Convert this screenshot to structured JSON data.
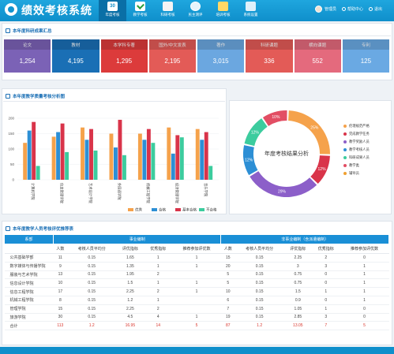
{
  "app": {
    "title": "绩效考核系统"
  },
  "nav": [
    {
      "label": "年度考核",
      "icon": "calendar-icon",
      "badge": "30"
    },
    {
      "label": "教学考核",
      "icon": "checklist-icon"
    },
    {
      "label": "科研考核",
      "icon": "researcher-icon"
    },
    {
      "label": "民主测评",
      "icon": "globe-icon"
    },
    {
      "label": "培训考核",
      "icon": "note-icon"
    },
    {
      "label": "系统设置",
      "icon": "document-icon"
    }
  ],
  "user": {
    "name": "管理员",
    "help": "帮助中心",
    "logout": "退出"
  },
  "summary": {
    "title": "本年度科研成果汇总",
    "cards": [
      {
        "label": "论文",
        "value": "1,254",
        "color": "#7b62b6"
      },
      {
        "label": "教材",
        "value": "4,195",
        "color": "#1a6fb5"
      },
      {
        "label": "本学科专著",
        "value": "1,295",
        "color": "#dc3b3b"
      },
      {
        "label": "国外/中文发表",
        "value": "2,195",
        "color": "#e35b57"
      },
      {
        "label": "著作",
        "value": "3,015",
        "color": "#6ba7e0"
      },
      {
        "label": "科研课题",
        "value": "336",
        "color": "#e35b57"
      },
      {
        "label": "横向课题",
        "value": "552",
        "color": "#e46a7d"
      },
      {
        "label": "专利",
        "value": "125",
        "color": "#6aa9e3"
      }
    ]
  },
  "bar_section": {
    "title": "本年度教学质量考核分析图"
  },
  "chart_data": [
    {
      "type": "bar",
      "categories": [
        "计算机学院",
        "信息管理学院",
        "艺术设计学院",
        "外国语学院",
        "机械工程学院",
        "经济管理学院",
        "音乐学院"
      ],
      "ylim": [
        0,
        200
      ],
      "yticks": [
        0,
        50,
        100,
        150,
        200
      ],
      "series": [
        {
          "name": "优秀",
          "color": "#f5a24b",
          "values": [
            120,
            140,
            170,
            150,
            150,
            170,
            165
          ]
        },
        {
          "name": "合格",
          "color": "#2d8fd5",
          "values": [
            160,
            155,
            130,
            105,
            130,
            85,
            130
          ]
        },
        {
          "name": "基本合格",
          "color": "#d9344a",
          "values": [
            188,
            183,
            165,
            195,
            165,
            145,
            155
          ]
        },
        {
          "name": "不合格",
          "color": "#3ccc9e",
          "values": [
            45,
            90,
            95,
            80,
            120,
            138,
            45
          ]
        }
      ],
      "legend": "bottom"
    },
    {
      "type": "pie",
      "title": "年度考核结果分析",
      "series": [
        {
          "name": "伦理规范严格",
          "color": "#f5a24b",
          "value": 25
        },
        {
          "name": "完成教学任务",
          "color": "#d9344a",
          "value": 12
        },
        {
          "name": "教学奖励人员",
          "color": "#8c5fc9",
          "value": 29
        },
        {
          "name": "教学考核人员",
          "color": "#2d8fd5",
          "value": 12
        },
        {
          "name": "科研成果人员",
          "color": "#3ccc9e",
          "value": 12
        },
        {
          "name": "教学类",
          "color": "#e24e64",
          "value": 10
        },
        {
          "name": "辅导员",
          "color": "#f0a030",
          "value": 0
        }
      ],
      "labels": [
        "25%",
        "12%",
        "29%",
        "12%",
        "12%",
        "10%"
      ],
      "legend": "right"
    }
  ],
  "table_section": {
    "title": "本年度教学人员考核评优推荐表",
    "head": {
      "dept": "系部",
      "group1": "事业编制",
      "group2": "非事业编制（含派遣编制）"
    },
    "subhead": [
      "人数",
      "考核人员平均分",
      "评优指标",
      "优秀指标",
      "推荐参加评优数",
      "人数",
      "考核人员平均分",
      "评优指标",
      "优秀指标",
      "推荐参加评优数"
    ],
    "rows": [
      {
        "dept": "公共基础学部",
        "cells": [
          "11",
          "0.15",
          "1.65",
          "1",
          "1",
          "15",
          "0.15",
          "2.25",
          "2",
          "0"
        ]
      },
      {
        "dept": "数字媒体与传播学院",
        "cells": [
          "9",
          "0.15",
          "1.35",
          "1",
          "1",
          "20",
          "0.15",
          "3",
          "3",
          "1"
        ]
      },
      {
        "dept": "服装与艺术学院",
        "cells": [
          "13",
          "0.15",
          "1.95",
          "2",
          "",
          "5",
          "0.15",
          "0.75",
          "0",
          "1"
        ]
      },
      {
        "dept": "信息设计学院",
        "cells": [
          "10",
          "0.15",
          "1.5",
          "1",
          "1",
          "5",
          "0.15",
          "0.75",
          "0",
          "1"
        ]
      },
      {
        "dept": "信息工程学院",
        "cells": [
          "17",
          "0.15",
          "2.25",
          "2",
          "1",
          "10",
          "0.15",
          "1.5",
          "1",
          "1"
        ]
      },
      {
        "dept": "机械工程学院",
        "cells": [
          "8",
          "0.15",
          "1.2",
          "1",
          "",
          "6",
          "0.15",
          "0.9",
          "0",
          "1"
        ]
      },
      {
        "dept": "管理学院",
        "cells": [
          "15",
          "0.15",
          "2.25",
          "2",
          "",
          "7",
          "0.15",
          "1.05",
          "1",
          "0"
        ]
      },
      {
        "dept": "旅游学院",
        "cells": [
          "30",
          "0.15",
          "4.5",
          "4",
          "1",
          "19",
          "0.15",
          "2.85",
          "3",
          "0"
        ]
      }
    ],
    "total": {
      "dept": "合计",
      "cells": [
        "113",
        "1.2",
        "16.95",
        "14",
        "5",
        "87",
        "1.2",
        "13.05",
        "7",
        "5"
      ]
    }
  }
}
